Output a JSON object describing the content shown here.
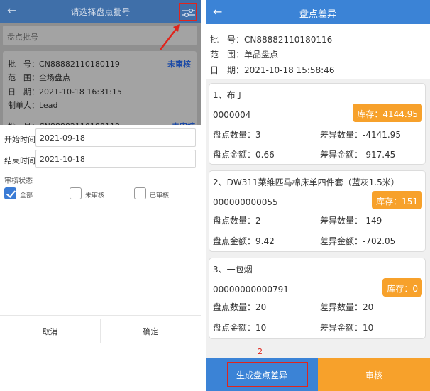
{
  "left": {
    "header": {
      "back_icon": "arrow-left-icon",
      "title": "请选择盘点批号",
      "filter_icon": "filter-sliders-icon"
    },
    "batch_placeholder": "盘点批号",
    "card": {
      "batch": "批　号：CN88882110180119",
      "scope": "范　围：全场盘点",
      "date": "日　期：2021-10-18 16:31:15",
      "creator": "制单人：Lead",
      "status": "未审核"
    },
    "card2": {
      "batch": "批　号：CN88882110180118",
      "status": "未审核"
    },
    "filter_form": {
      "start_label": "开始时间",
      "start_value": "2021-09-18",
      "end_label": "结束时间",
      "end_value": "2021-10-18",
      "status_title": "审核状态",
      "options": [
        {
          "label": "全部",
          "checked": true
        },
        {
          "label": "未审核",
          "checked": false
        },
        {
          "label": "已审核",
          "checked": false
        }
      ],
      "cancel": "取消",
      "confirm": "确定"
    },
    "annotation_color": "#e0251c"
  },
  "right": {
    "header": {
      "back_icon": "arrow-left-icon",
      "title": "盘点差异"
    },
    "info": {
      "batch": "批　号：CN88882110180116",
      "scope": "范　围：单品盘点",
      "date": "日　期：2021-10-18 15:58:46"
    },
    "items": [
      {
        "name": "1、布丁",
        "code": "0000004",
        "stock": "库存：4144.95",
        "count": "盘点数量：3",
        "diff_count": "差异数量：-4141.95",
        "amount": "盘点金额：0.66",
        "diff_amount": "差异金额：-917.45"
      },
      {
        "name": "2、DW311莱维匹马棉床单四件套（蓝灰1.5米）",
        "code": "000000000055",
        "stock": "库存：151",
        "count": "盘点数量：2",
        "diff_count": "差异数量：-149",
        "amount": "盘点金额：9.42",
        "diff_amount": "差异金额：-702.05"
      },
      {
        "name": "3、一包烟",
        "code": "00000000000791",
        "stock": "库存：0",
        "count": "盘点数量：20",
        "diff_count": "差异数量：20",
        "amount": "盘点金额：10",
        "diff_amount": "差异金额：10"
      }
    ],
    "step_marker": "2",
    "generate_button": "生成盘点差异",
    "audit_button": "审核",
    "colors": {
      "primary": "#3b83d6",
      "accent": "#f7a12b"
    }
  }
}
